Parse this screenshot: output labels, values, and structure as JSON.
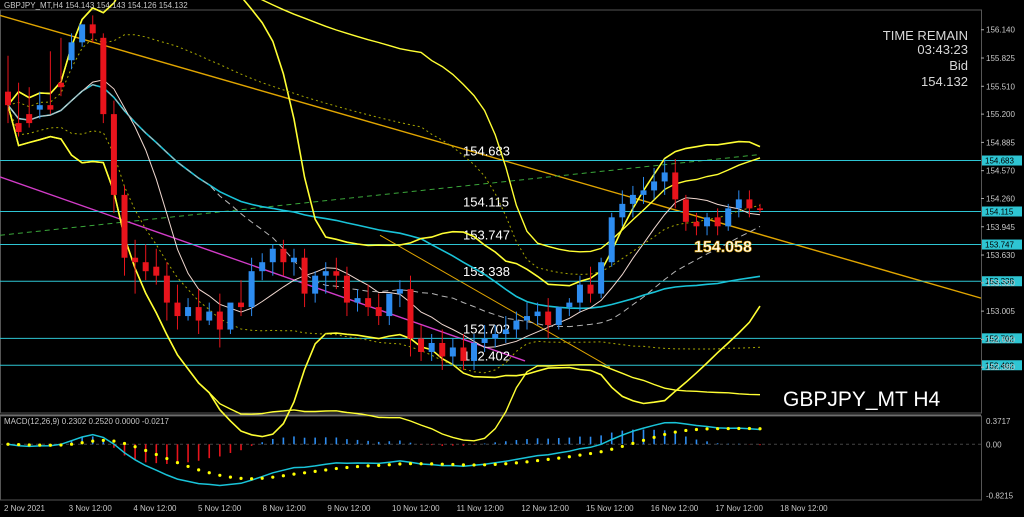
{
  "window_title": "GBPJPY_MT,H4 154.143 154.143 154.126 154.132",
  "watermark": "GBPJPY_MT H4",
  "time_remain": {
    "label": "TIME REMAIN",
    "value": "03:43:23",
    "bid_label": "Bid",
    "bid_value": "154.132"
  },
  "current_price_tag": "154.058",
  "colors": {
    "background": "#000000",
    "bull": "#2d8cf0",
    "bear": "#e8141c",
    "level_line": "#2ec5d3",
    "ma_cyan": "#19c3d8",
    "band_yellow": "#ffff33",
    "trend_orange": "#e0a500",
    "trend_magenta": "#d23cc8",
    "macd_signal": "#ffff00"
  },
  "chart_data": {
    "type": "candlestick",
    "symbol": "GBPJPY_MT",
    "timeframe": "H4",
    "ylim": [
      151.87,
      156.36
    ],
    "y_ticks": [
      "156.140",
      "155.825",
      "155.510",
      "155.200",
      "154.885",
      "154.570",
      "154.260",
      "153.945",
      "153.630",
      "153.320",
      "153.005",
      "152.690",
      "152.380"
    ],
    "x_labels": [
      "2 Nov 2021",
      "3 Nov 12:00",
      "4 Nov 12:00",
      "5 Nov 12:00",
      "8 Nov 12:00",
      "9 Nov 12:00",
      "10 Nov 12:00",
      "11 Nov 12:00",
      "12 Nov 12:00",
      "15 Nov 12:00",
      "16 Nov 12:00",
      "17 Nov 12:00",
      "18 Nov 12:00"
    ],
    "levels": [
      {
        "price": 154.683,
        "label": "154.683",
        "tag": "154.683"
      },
      {
        "price": 154.115,
        "label": "154.115",
        "tag": "154.115"
      },
      {
        "price": 153.747,
        "label": "153.747",
        "tag": "153.747"
      },
      {
        "price": 153.338,
        "label": "153.338",
        "tag": "153.338"
      },
      {
        "price": 152.702,
        "label": "152.702",
        "tag": "152.702"
      },
      {
        "price": 152.402,
        "label": "152.402",
        "tag": "152.402"
      }
    ],
    "candles": [
      [
        155.45,
        155.85,
        155.3,
        155.1
      ],
      [
        155.1,
        155.55,
        155.0,
        154.95
      ],
      [
        155.2,
        155.5,
        155.1,
        155.05
      ],
      [
        155.25,
        155.45,
        155.3,
        155.15
      ],
      [
        155.3,
        155.9,
        155.25,
        155.2
      ],
      [
        155.55,
        156.05,
        155.5,
        155.4
      ],
      [
        155.8,
        156.1,
        156.0,
        155.7
      ],
      [
        156.0,
        156.2,
        156.2,
        155.95
      ],
      [
        156.2,
        156.3,
        156.1,
        156.0
      ],
      [
        156.05,
        156.1,
        155.2,
        155.1
      ],
      [
        155.2,
        155.35,
        154.3,
        154.1
      ],
      [
        154.3,
        154.4,
        153.6,
        153.4
      ],
      [
        153.6,
        153.8,
        153.55,
        153.2
      ],
      [
        153.55,
        153.75,
        153.45,
        153.35
      ],
      [
        153.5,
        153.7,
        153.4,
        153.3
      ],
      [
        153.4,
        153.55,
        153.1,
        152.9
      ],
      [
        153.1,
        153.3,
        152.95,
        152.8
      ],
      [
        152.95,
        153.15,
        153.05,
        152.9
      ],
      [
        153.05,
        153.25,
        152.9,
        152.75
      ],
      [
        152.9,
        153.1,
        153.0,
        152.85
      ],
      [
        153.0,
        153.2,
        152.8,
        152.6
      ],
      [
        152.8,
        153.0,
        153.1,
        152.75
      ],
      [
        153.1,
        153.35,
        153.05,
        152.95
      ],
      [
        153.05,
        153.6,
        153.45,
        152.95
      ],
      [
        153.45,
        153.65,
        153.55,
        153.35
      ],
      [
        153.55,
        153.75,
        153.7,
        153.4
      ],
      [
        153.7,
        153.8,
        153.55,
        153.4
      ],
      [
        153.55,
        153.7,
        153.6,
        153.4
      ],
      [
        153.6,
        153.7,
        153.2,
        153.05
      ],
      [
        153.2,
        153.45,
        153.4,
        153.1
      ],
      [
        153.4,
        153.55,
        153.45,
        153.2
      ],
      [
        153.45,
        153.6,
        153.4,
        153.25
      ],
      [
        153.4,
        153.5,
        153.1,
        152.95
      ],
      [
        153.1,
        153.25,
        153.15,
        153.0
      ],
      [
        153.15,
        153.3,
        153.05,
        152.95
      ],
      [
        153.05,
        153.2,
        152.95,
        152.85
      ],
      [
        152.95,
        153.1,
        153.2,
        152.85
      ],
      [
        153.2,
        153.35,
        153.25,
        153.05
      ],
      [
        153.25,
        153.4,
        152.7,
        152.5
      ],
      [
        152.7,
        152.85,
        152.55,
        152.45
      ],
      [
        152.55,
        152.75,
        152.65,
        152.45
      ],
      [
        152.65,
        152.8,
        152.5,
        152.35
      ],
      [
        152.5,
        152.7,
        152.6,
        152.4
      ],
      [
        152.6,
        152.75,
        152.45,
        152.35
      ],
      [
        152.45,
        152.75,
        152.65,
        152.35
      ],
      [
        152.65,
        152.85,
        152.7,
        152.55
      ],
      [
        152.7,
        152.85,
        152.75,
        152.6
      ],
      [
        152.75,
        152.95,
        152.8,
        152.65
      ],
      [
        152.8,
        153.0,
        152.9,
        152.7
      ],
      [
        152.9,
        153.1,
        152.95,
        152.8
      ],
      [
        152.95,
        153.1,
        153.0,
        152.85
      ],
      [
        153.0,
        153.15,
        152.85,
        152.7
      ],
      [
        152.85,
        153.05,
        153.05,
        152.8
      ],
      [
        153.05,
        153.15,
        153.1,
        152.95
      ],
      [
        153.1,
        153.4,
        153.3,
        153.0
      ],
      [
        153.3,
        153.5,
        153.2,
        153.1
      ],
      [
        153.2,
        153.6,
        153.55,
        153.15
      ],
      [
        153.55,
        154.1,
        154.05,
        153.5
      ],
      [
        154.05,
        154.35,
        154.2,
        153.95
      ],
      [
        154.2,
        154.4,
        154.3,
        154.05
      ],
      [
        154.3,
        154.5,
        154.35,
        154.2
      ],
      [
        154.35,
        154.6,
        154.45,
        154.25
      ],
      [
        154.45,
        154.7,
        154.55,
        154.3
      ],
      [
        154.55,
        154.7,
        154.25,
        154.15
      ],
      [
        154.25,
        154.3,
        154.0,
        153.9
      ],
      [
        154.0,
        154.1,
        153.95,
        153.85
      ],
      [
        153.95,
        154.1,
        154.05,
        153.85
      ],
      [
        154.05,
        154.15,
        153.95,
        153.85
      ],
      [
        153.95,
        154.2,
        154.15,
        153.9
      ],
      [
        154.15,
        154.35,
        154.25,
        154.05
      ],
      [
        154.25,
        154.35,
        154.15,
        154.05
      ],
      [
        154.15,
        154.2,
        154.132,
        154.1
      ]
    ],
    "macd": {
      "label": "MACD(12,26,9) 0.2302 0.2520 0.0000 -0.0217",
      "ylim": [
        -0.86,
        0.42
      ],
      "y_ticks": [
        "0.3717",
        "0.00",
        "-0.8215"
      ]
    }
  }
}
